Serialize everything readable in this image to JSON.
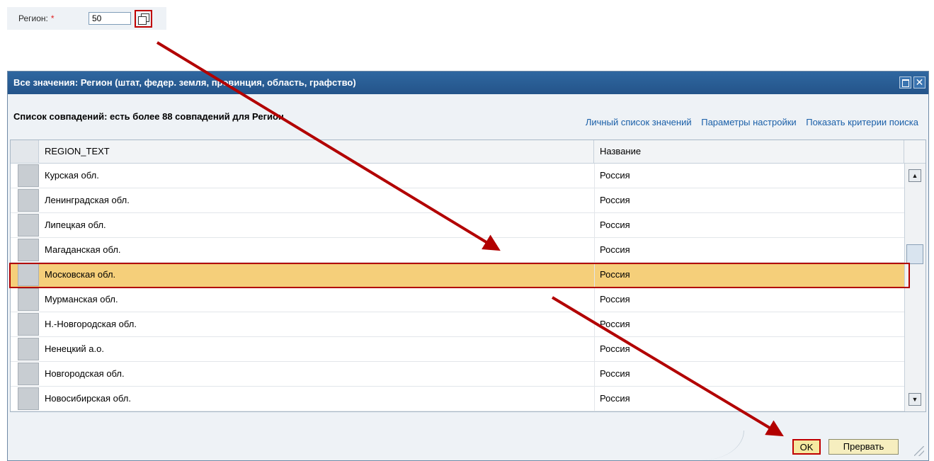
{
  "field": {
    "label": "Регион:",
    "required_mark": "*",
    "value": "50"
  },
  "dialog": {
    "title": "Все значения: Регион (штат, федер. земля, провинция, область, графство)",
    "list_title": "Список совпадений: есть более 88 совпадений для Регион",
    "links": [
      "Личный список значений",
      "Параметры настройки",
      "Показать критерии поиска"
    ],
    "columns": [
      "REGION_TEXT",
      "Название"
    ],
    "rows": [
      {
        "region": "Курская обл.",
        "name": "Россия"
      },
      {
        "region": "Ленинградская обл.",
        "name": "Россия"
      },
      {
        "region": "Липецкая обл.",
        "name": "Россия"
      },
      {
        "region": "Магаданская обл.",
        "name": "Россия"
      },
      {
        "region": "Московская обл.",
        "name": "Россия",
        "selected": true
      },
      {
        "region": "Мурманская обл.",
        "name": "Россия"
      },
      {
        "region": "Н.-Новгородская обл.",
        "name": "Россия"
      },
      {
        "region": "Ненецкий а.о.",
        "name": "Россия"
      },
      {
        "region": "Новгородская обл.",
        "name": "Россия"
      },
      {
        "region": "Новосибирская обл.",
        "name": "Россия"
      }
    ],
    "buttons": {
      "ok": "OK",
      "cancel": "Прервать"
    },
    "title_close": "✕"
  },
  "colors": {
    "selected_row": "#f5cf7a",
    "annotation": "#b20000",
    "titlebar": "#2f67a0"
  }
}
